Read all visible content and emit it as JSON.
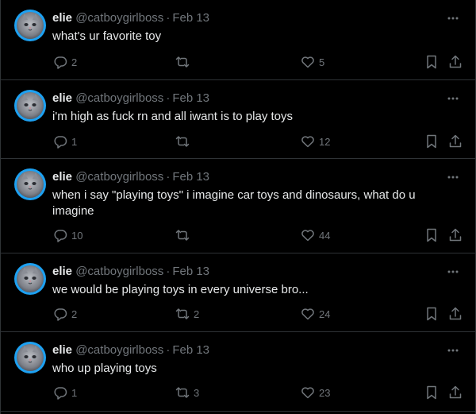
{
  "colors": {
    "background": "#000000",
    "text": "#e7e9ea",
    "muted": "#71767b",
    "divider": "#2f3336"
  },
  "icons": {
    "more": "more-horizontal-icon",
    "reply": "reply-icon",
    "retweet": "retweet-icon",
    "like": "heart-icon",
    "bookmark": "bookmark-icon",
    "share": "share-icon"
  },
  "tweets": [
    {
      "name": "elie",
      "handle": "@catboygirlboss",
      "separator": "·",
      "date": "Feb 13",
      "text": "what's ur favorite toy",
      "replies": "2",
      "retweets": "",
      "likes": "5"
    },
    {
      "name": "elie",
      "handle": "@catboygirlboss",
      "separator": "·",
      "date": "Feb 13",
      "text": "i'm high as fuck rn and all iwant is to play toys",
      "replies": "1",
      "retweets": "",
      "likes": "12"
    },
    {
      "name": "elie",
      "handle": "@catboygirlboss",
      "separator": "·",
      "date": "Feb 13",
      "text": "when i say \"playing toys\" i imagine car toys and dinosaurs, what do u imagine",
      "replies": "10",
      "retweets": "",
      "likes": "44"
    },
    {
      "name": "elie",
      "handle": "@catboygirlboss",
      "separator": "·",
      "date": "Feb 13",
      "text": "we would be playing toys in every universe bro...",
      "replies": "2",
      "retweets": "2",
      "likes": "24"
    },
    {
      "name": "elie",
      "handle": "@catboygirlboss",
      "separator": "·",
      "date": "Feb 13",
      "text": "who up playing toys",
      "replies": "1",
      "retweets": "3",
      "likes": "23"
    }
  ]
}
